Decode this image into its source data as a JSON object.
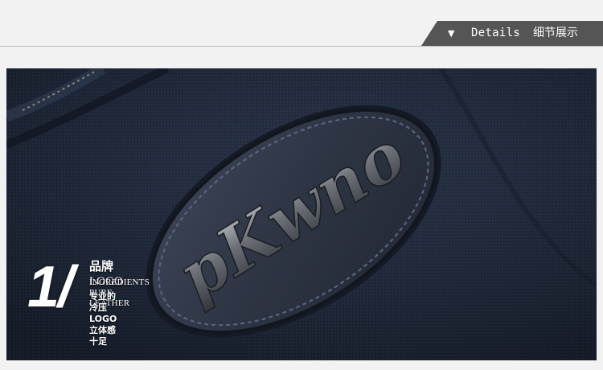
{
  "header": {
    "arrow": "▼",
    "details_en": "Details",
    "details_cn": "细节展示"
  },
  "photo": {
    "brand_badge_text": "pKwno",
    "caption_number": "1/",
    "caption_title_cn": "品牌",
    "caption_title_logo": "LOGO",
    "caption_en": "INGREDIENTS PURE LEATHER",
    "caption_cn": "专业的冷压LOGO立体感十足"
  },
  "colors": {
    "header_background": "#f2f2f2",
    "tab_background": "#555555",
    "fabric": "#1e2634",
    "leather": "#2f3645",
    "stitch": "#4a5873",
    "metal": "#8c8f96"
  }
}
